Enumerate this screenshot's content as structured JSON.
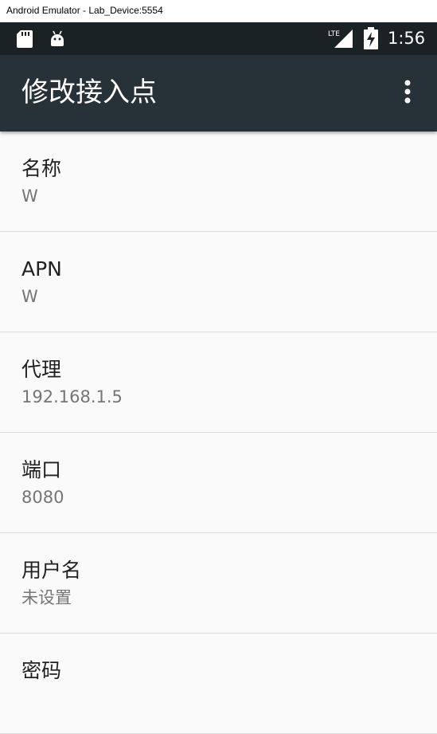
{
  "window": {
    "title": "Android Emulator - Lab_Device:5554"
  },
  "status_bar": {
    "time": "1:56",
    "network_label": "LTE",
    "icons": [
      "sd-card-icon",
      "android-debug-icon",
      "lte-signal-icon",
      "battery-charging-icon"
    ]
  },
  "app_bar": {
    "title": "修改接入点",
    "overflow_icon": "more-vert-icon"
  },
  "preferences": [
    {
      "title": "名称",
      "summary": "W"
    },
    {
      "title": "APN",
      "summary": "W"
    },
    {
      "title": "代理",
      "summary": "192.168.1.5"
    },
    {
      "title": "端口",
      "summary": "8080"
    },
    {
      "title": "用户名",
      "summary": "未设置"
    },
    {
      "title": "密码",
      "summary": ""
    }
  ],
  "colors": {
    "status_bar": "#1b2226",
    "app_bar": "#263238",
    "background": "#fafafa",
    "title_text": "#212121",
    "summary_text": "#757575",
    "divider": "#dcdcdc"
  }
}
